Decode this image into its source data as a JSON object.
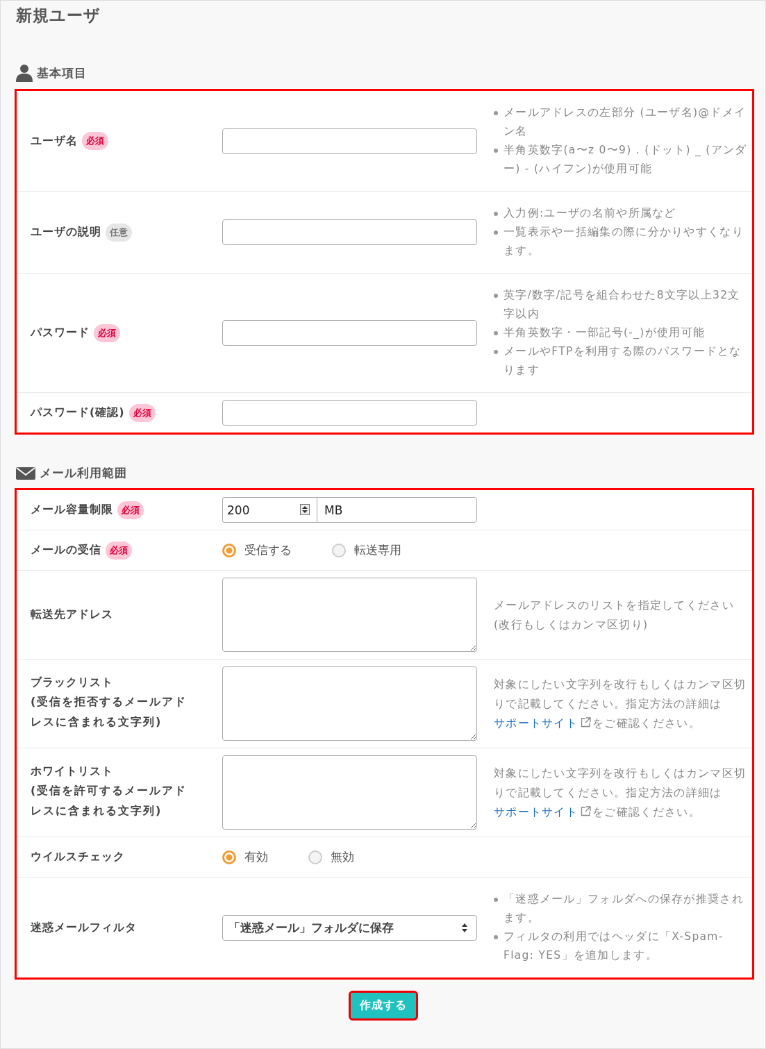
{
  "page": {
    "title": "新規ユーザ"
  },
  "sections": [
    {
      "kind": "basic",
      "title": "基本項目",
      "highlighted": true,
      "rows": [
        {
          "kind": "text",
          "label": "ユーザ名",
          "badge": {
            "kind": "required",
            "text": "必須"
          },
          "notes": [
            "メールアドレスの左部分 (ユーザ名)@ドメイン名",
            "半角英数字(a〜z 0〜9) . (ドット) _ (アンダー) - (ハイフン)が使用可能"
          ]
        },
        {
          "kind": "text",
          "label": "ユーザの説明",
          "badge": {
            "kind": "optional",
            "text": "任意"
          },
          "notes": [
            "入力例:ユーザの名前や所属など",
            "一覧表示や一括編集の際に分かりやすくなります。"
          ]
        },
        {
          "kind": "text",
          "label": "パスワード",
          "badge": {
            "kind": "required",
            "text": "必須"
          },
          "notes": [
            "英字/数字/記号を組合わせた8文字以上32文字以内",
            "半角英数字・一部記号(-_)が使用可能",
            "メールやFTPを利用する際のパスワードとなります"
          ]
        },
        {
          "kind": "text",
          "label": "パスワード(確認)",
          "badge": {
            "kind": "required",
            "text": "必須"
          }
        }
      ]
    },
    {
      "kind": "mail",
      "title": "メール利用範囲",
      "highlighted": true,
      "rows": [
        {
          "kind": "number",
          "label": "メール容量制限",
          "badge": {
            "kind": "required",
            "text": "必須"
          },
          "value": "200",
          "unit": "MB"
        },
        {
          "kind": "radio",
          "label": "メールの受信",
          "badge": {
            "kind": "required",
            "text": "必須"
          },
          "options": [
            {
              "label": "受信する",
              "selected": true
            },
            {
              "label": "転送専用",
              "selected": false
            }
          ]
        },
        {
          "kind": "textarea",
          "label": "転送先アドレス",
          "help": {
            "text": "メールアドレスのリストを指定してください(改行もしくはカンマ区切り)"
          }
        },
        {
          "kind": "textarea",
          "label": "ブラックリスト",
          "sublabel": "(受信を拒否するメールアドレスに含まれる文字列)",
          "help": {
            "text": "対象にしたい文字列を改行もしくはカンマ区切りで記載してください。指定方法の詳細は",
            "link": "サポートサイト",
            "after": "をご確認ください。"
          }
        },
        {
          "kind": "textarea",
          "label": "ホワイトリスト",
          "sublabel": "(受信を許可するメールアドレスに含まれる文字列)",
          "help": {
            "text": "対象にしたい文字列を改行もしくはカンマ区切りで記載してください。指定方法の詳細は",
            "link": "サポートサイト",
            "after": "をご確認ください。"
          }
        },
        {
          "kind": "radio",
          "label": "ウイルスチェック",
          "options": [
            {
              "label": "有効",
              "selected": true
            },
            {
              "label": "無効",
              "selected": false
            }
          ]
        },
        {
          "kind": "select",
          "label": "迷惑メールフィルタ",
          "value": "「迷惑メール」フォルダに保存",
          "notes": [
            "「迷惑メール」フォルダへの保存が推奨されます。",
            "フィルタの利用ではヘッダに「X-Spam-Flag: YES」を追加します。"
          ]
        }
      ]
    }
  ],
  "button": {
    "label": "作成する",
    "highlighted": true
  }
}
